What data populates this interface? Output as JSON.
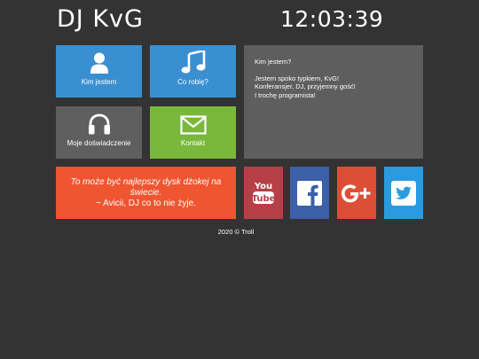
{
  "header": {
    "title": "DJ KvG",
    "clock": "12:03:39"
  },
  "tiles": {
    "about": {
      "label": "Kim jestem",
      "color": "#3a8fd0",
      "icon": "user-icon"
    },
    "music": {
      "label": "Co robię?",
      "color": "#3a8fd0",
      "icon": "music-note-icon"
    },
    "experience": {
      "label": "Moje doświadczenie",
      "color": "#5f5f5f",
      "icon": "headphones-icon"
    },
    "contact": {
      "label": "Kontakt",
      "color": "#79b83a",
      "icon": "envelope-icon"
    }
  },
  "info": {
    "question": "Kim jestem?",
    "lines": [
      "Jestem spoko typkiem, KvG!",
      "Konferansjer, DJ, przyjemny gość!",
      "I trochę programista!"
    ]
  },
  "quote": {
    "text": "To może być najlepszy dysk dżokej na świecie.",
    "author": "~ Avicii, DJ co to nie żyje.",
    "color": "#ef5530"
  },
  "social": [
    {
      "name": "youtube",
      "icon": "youtube-icon",
      "color": "#b73f48"
    },
    {
      "name": "facebook",
      "icon": "facebook-icon",
      "color": "#3b5fa8"
    },
    {
      "name": "google-plus",
      "icon": "google-plus-icon",
      "color": "#dd4e37"
    },
    {
      "name": "twitter",
      "icon": "twitter-icon",
      "color": "#2b9be0"
    }
  ],
  "footer": {
    "text": "2020 © Troll"
  }
}
